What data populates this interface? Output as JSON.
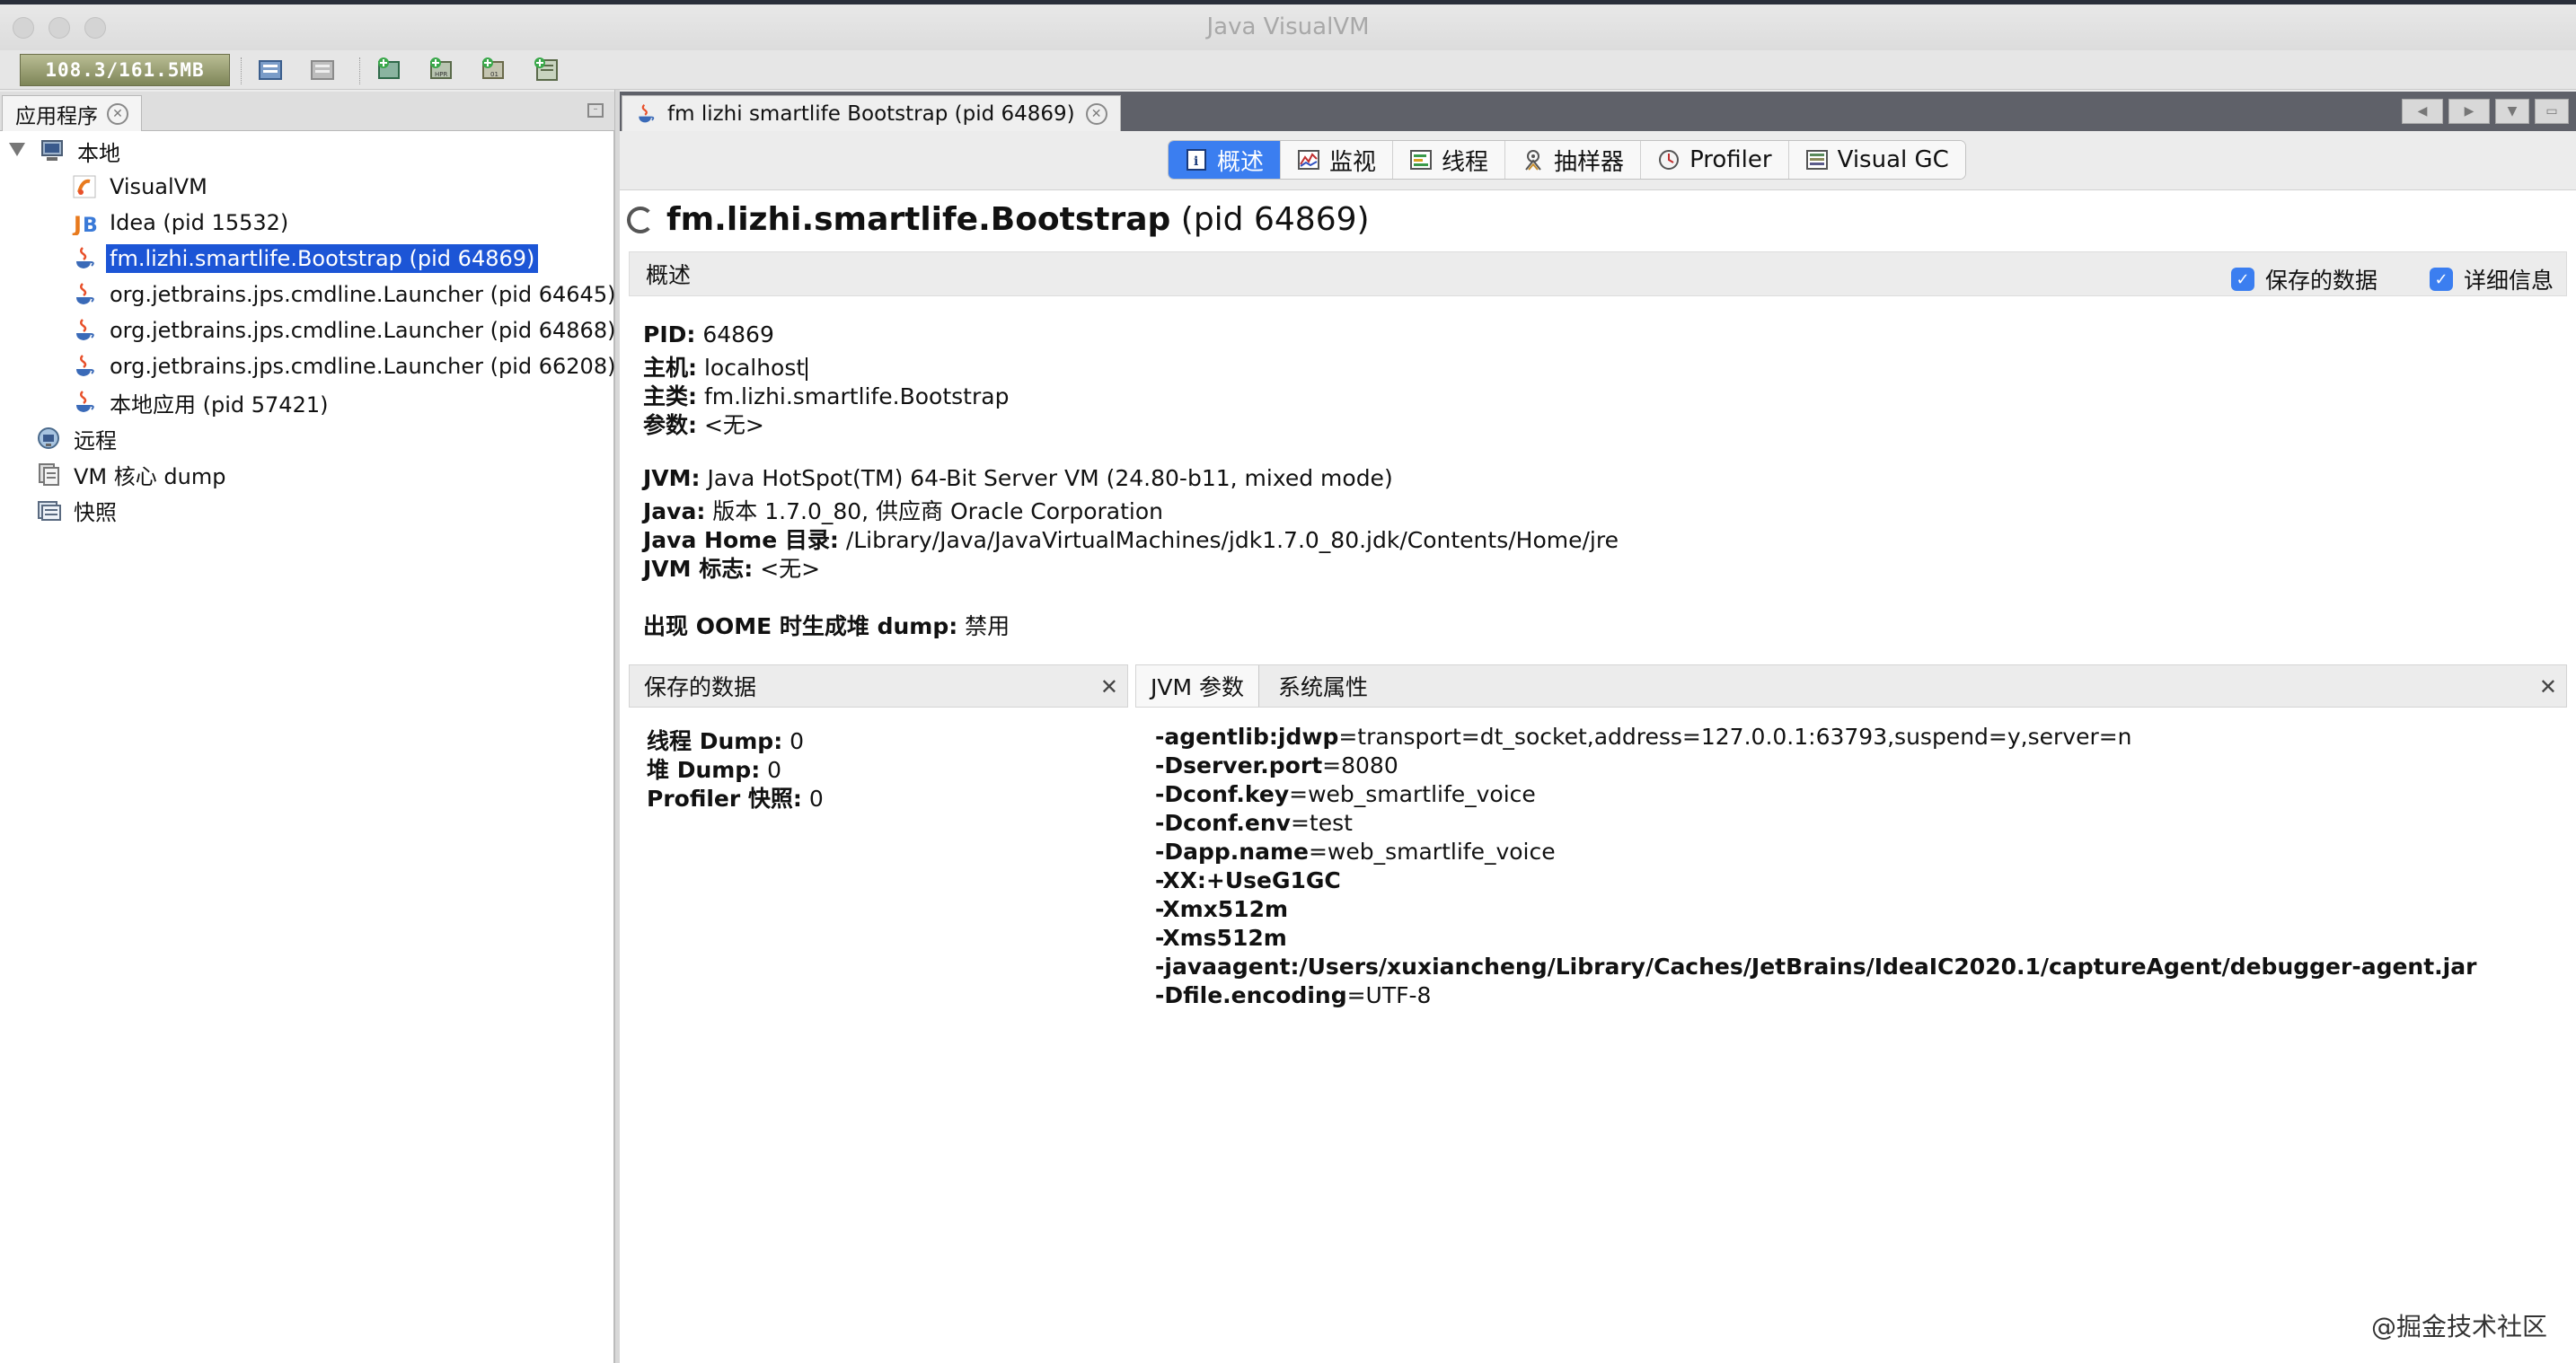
{
  "window": {
    "title": "Java VisualVM"
  },
  "toolbar": {
    "memory": "108.3/161.5MB"
  },
  "left": {
    "tab_label": "应用程序",
    "tree": {
      "local": "本地",
      "visualvm": "VisualVM",
      "idea": "Idea (pid 15532)",
      "bootstrap": "fm.lizhi.smartlife.Bootstrap (pid 64869)",
      "launcher1": "org.jetbrains.jps.cmdline.Launcher (pid 64645)",
      "launcher2": "org.jetbrains.jps.cmdline.Launcher (pid 64868)",
      "launcher3": "org.jetbrains.jps.cmdline.Launcher (pid 66208)",
      "localapp": "本地应用 (pid 57421)",
      "remote": "远程",
      "coredump": "VM 核心 dump",
      "snapshot": "快照"
    }
  },
  "right": {
    "tab_label": "fm lizhi smartlife Bootstrap (pid 64869)",
    "views": [
      "概述",
      "监视",
      "线程",
      "抽样器",
      "Profiler",
      "Visual GC"
    ],
    "heading_bold": "fm.lizhi.smartlife.Bootstrap",
    "heading_rest": "(pid 64869)",
    "section_title": "概述",
    "cb_saved": "保存的数据",
    "cb_details": "详细信息",
    "info": {
      "pid_k": "PID:",
      "pid_v": "64869",
      "host_k": "主机:",
      "host_v": "localhost",
      "main_k": "主类:",
      "main_v": "fm.lizhi.smartlife.Bootstrap",
      "args_k": "参数:",
      "args_v": "<无>",
      "jvm_k": "JVM:",
      "jvm_v": "Java HotSpot(TM) 64-Bit Server VM (24.80-b11, mixed mode)",
      "java_k": "Java:",
      "java_v": "版本 1.7.0_80, 供应商 Oracle Corporation",
      "home_k": "Java Home 目录:",
      "home_v": "/Library/Java/JavaVirtualMachines/jdk1.7.0_80.jdk/Contents/Home/jre",
      "flags_k": "JVM 标志:",
      "flags_v": "<无>",
      "oome_k": "出现 OOME 时生成堆 dump:",
      "oome_v": "禁用"
    },
    "saved": {
      "title": "保存的数据",
      "thread_k": "线程 Dump:",
      "thread_v": "0",
      "heap_k": "堆 Dump:",
      "heap_v": "0",
      "prof_k": "Profiler 快照:",
      "prof_v": "0"
    },
    "jvm_tabs": [
      "JVM 参数",
      "系统属性"
    ],
    "jvm_args": [
      {
        "k": "-agentlib:jdwp",
        "v": "=transport=dt_socket,address=127.0.0.1:63793,suspend=y,server=n"
      },
      {
        "k": "-Dserver.port",
        "v": "=8080"
      },
      {
        "k": "-Dconf.key",
        "v": "=web_smartlife_voice"
      },
      {
        "k": "-Dconf.env",
        "v": "=test"
      },
      {
        "k": "-Dapp.name",
        "v": "=web_smartlife_voice"
      },
      {
        "k": "-XX:+UseG1GC",
        "v": ""
      },
      {
        "k": "-Xmx512m",
        "v": ""
      },
      {
        "k": "-Xms512m",
        "v": ""
      },
      {
        "k": "-javaagent:/Users/xuxiancheng/Library/Caches/JetBrains/IdeaIC2020.1/captureAgent/debugger-agent.jar",
        "v": ""
      },
      {
        "k": "-Dfile.encoding",
        "v": "=UTF-8"
      }
    ]
  },
  "watermark": "@掘金技术社区"
}
